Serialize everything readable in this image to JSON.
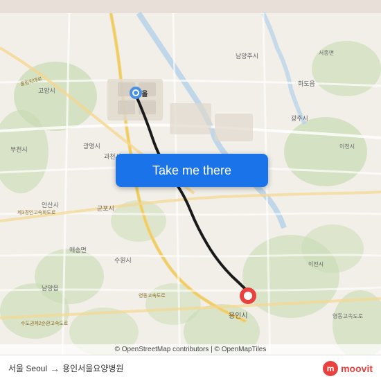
{
  "map": {
    "background_color": "#e8e0d8",
    "attribution": "© OpenStreetMap contributors | © OpenMapTiles",
    "origin_label": "서울 Seoul",
    "destination_label": "용인서울요양병원",
    "arrow": "→"
  },
  "button": {
    "label": "Take me there"
  },
  "branding": {
    "name": "moovit",
    "icon": "m"
  },
  "route_line": {
    "color": "#1a1a1a",
    "width": 3
  }
}
